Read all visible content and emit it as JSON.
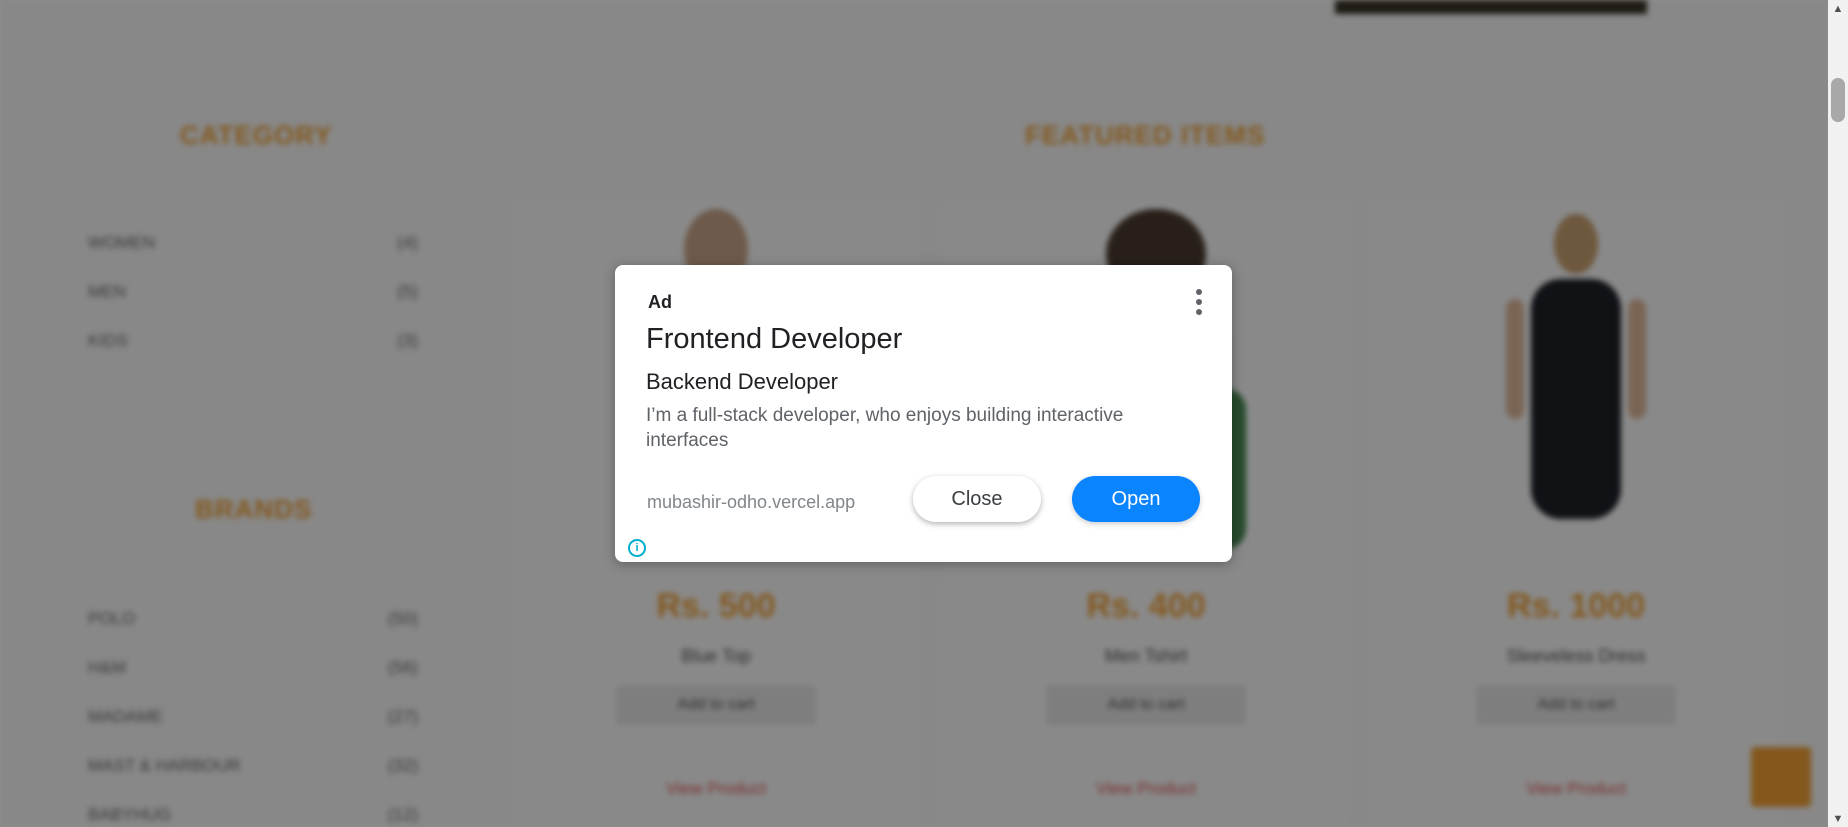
{
  "ad": {
    "label": "Ad",
    "headline": "Frontend Developer",
    "subheadline": "Backend Developer",
    "description": "I’m a full-stack developer, who enjoys building interactive interfaces",
    "url": "mubashir-odho.vercel.app",
    "close_label": "Close",
    "open_label": "Open",
    "menu_icon": "more-vert-icon",
    "info_icon": "info-icon",
    "info_glyph": "i",
    "open_color": "#0a84ff"
  },
  "background": {
    "category_title": "CATEGORY",
    "featured_title": "FEATURED ITEMS",
    "brands_title": "BRANDS",
    "categories": [
      {
        "name": "WOMEN",
        "count": "(4)"
      },
      {
        "name": "MEN",
        "count": "(5)"
      },
      {
        "name": "KIDS",
        "count": "(3)"
      }
    ],
    "brands": [
      {
        "name": "POLO",
        "count": "(50)"
      },
      {
        "name": "H&M",
        "count": "(56)"
      },
      {
        "name": "MADAME",
        "count": "(27)"
      },
      {
        "name": "MAST & HARBOUR",
        "count": "(32)"
      },
      {
        "name": "BABYHUG",
        "count": "(12)"
      }
    ],
    "products": [
      {
        "price": "Rs. 500",
        "name": "Blue Top",
        "cart": "Add to cart",
        "view": "View Product"
      },
      {
        "price": "Rs. 400",
        "name": "Men Tshirt",
        "cart": "Add to cart",
        "view": "View Product"
      },
      {
        "price": "Rs. 1000",
        "name": "Sleeveless Dress",
        "cart": "Add to cart",
        "view": "View Product"
      }
    ],
    "accent_color": "#f0a035"
  },
  "scrollbar": {
    "up_glyph": "▲",
    "down_glyph": "▼"
  }
}
